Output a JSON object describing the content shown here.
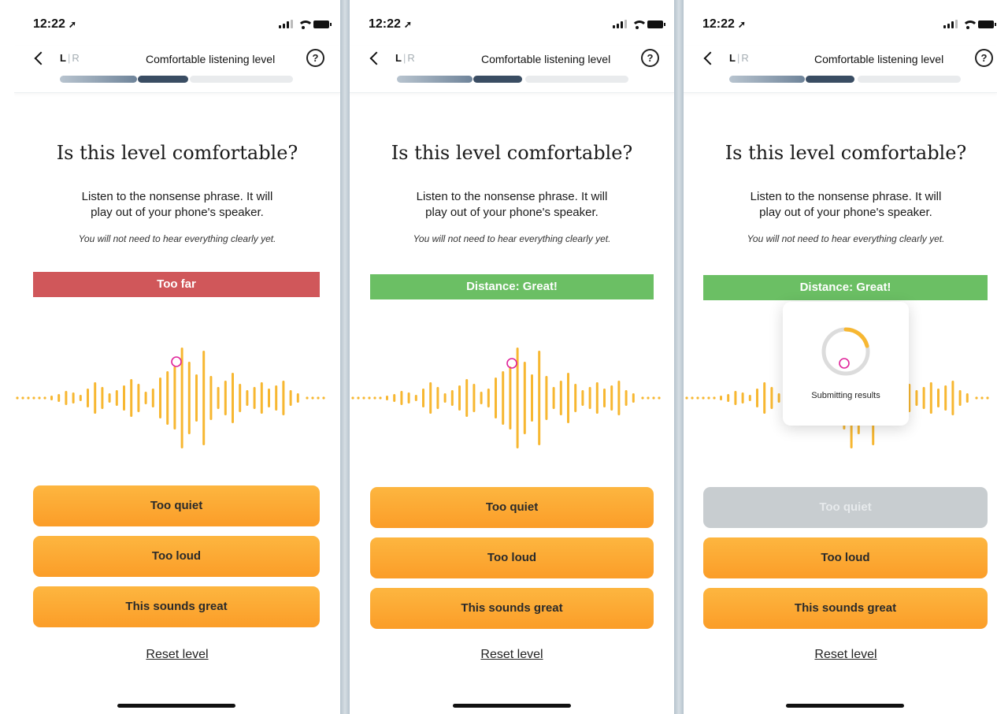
{
  "screens": [
    {
      "status": {
        "time": "12:22"
      },
      "nav": {
        "left": "L",
        "sep": "|",
        "right": "R",
        "title": "Comfortable listening level",
        "help": "?"
      },
      "heading": "Is this level comfortable?",
      "instruction_line1": "Listen to the nonsense phrase. It will",
      "instruction_line2": "play out of your phone's speaker.",
      "note": "You will not need to hear everything clearly yet.",
      "banner": {
        "text": "Too far",
        "color": "#d0575a"
      },
      "buttons": [
        "Too quiet",
        "Too loud",
        "This sounds great"
      ],
      "reset": "Reset level"
    },
    {
      "status": {
        "time": "12:22"
      },
      "nav": {
        "left": "L",
        "sep": "|",
        "right": "R",
        "title": "Comfortable listening level",
        "help": "?"
      },
      "heading": "Is this level comfortable?",
      "instruction_line1": "Listen to the nonsense phrase. It will",
      "instruction_line2": "play out of your phone's speaker.",
      "note": "You will not need to hear everything clearly yet.",
      "banner": {
        "text": "Distance: Great!",
        "color": "#6bbf64"
      },
      "buttons": [
        "Too quiet",
        "Too loud",
        "This sounds great"
      ],
      "reset": "Reset level"
    },
    {
      "status": {
        "time": "12:22"
      },
      "nav": {
        "left": "L",
        "sep": "|",
        "right": "R",
        "title": "Comfortable listening level",
        "help": "?"
      },
      "heading": "Is this level comfortable?",
      "instruction_line1": "Listen to the nonsense phrase. It will",
      "instruction_line2": "play out of your phone's speaker.",
      "note": "You will not need to hear everything clearly yet.",
      "banner": {
        "text": "Distance: Great!",
        "color": "#6bbf64"
      },
      "buttons": [
        "Too quiet",
        "Too loud",
        "This sounds great"
      ],
      "reset": "Reset level",
      "popup": {
        "label": "Submitting results"
      }
    }
  ],
  "colors": {
    "wave": "#f7b731",
    "marker": "#e0249a",
    "button_disabled": "#c8cdd0",
    "progress_done": "#7f93a6",
    "progress_current": "#3a4d63",
    "progress_remaining": "#e9ebed"
  },
  "icons": [
    "back-chevron-icon",
    "help-icon",
    "signal-icon",
    "wifi-icon",
    "battery-icon",
    "location-arrow-icon",
    "spinner-icon"
  ]
}
